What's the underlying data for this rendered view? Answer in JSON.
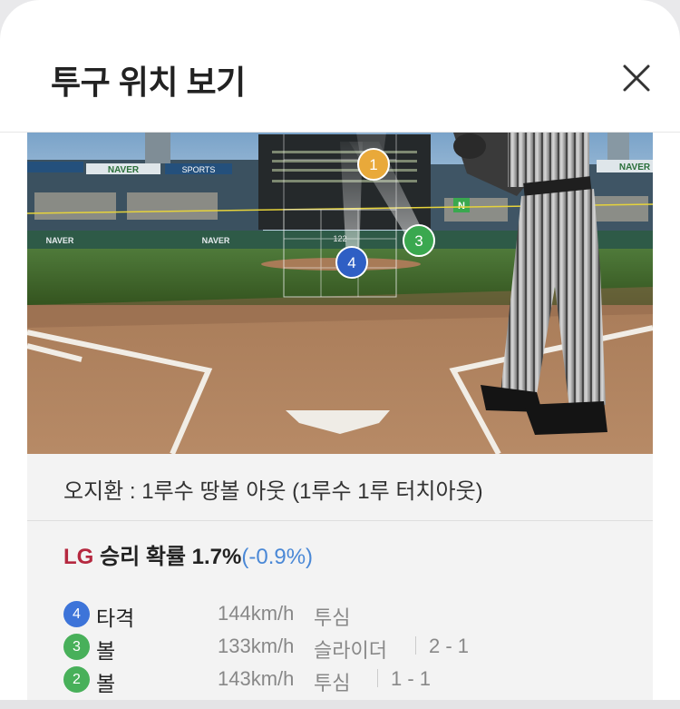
{
  "header": {
    "title": "투구 위치 보기"
  },
  "scene": {
    "banner_left": "NAVER",
    "banner_sports": "SPORTS",
    "banner_center": "NAVER",
    "banner_right": "NAVER",
    "zone_speed": "122",
    "markers": [
      {
        "number": "1",
        "color": "#e9a93a"
      },
      {
        "number": "3",
        "color": "#3aa84f"
      },
      {
        "number": "4",
        "color": "#2f5fc4"
      }
    ]
  },
  "play_result": "오지환 : 1루수 땅볼 아웃 (1루수 1루 터치아웃)",
  "win_probability": {
    "team": "LG",
    "label": "승리 확률 1.7%",
    "delta": "(-0.9%)"
  },
  "pitches": [
    {
      "number": "4",
      "color": "#3d74d9",
      "result": "타격",
      "speed": "144km/h",
      "type": "투심",
      "count": ""
    },
    {
      "number": "3",
      "color": "#48b05a",
      "result": "볼",
      "speed": "133km/h",
      "type": "슬라이더",
      "count": "2 - 1"
    },
    {
      "number": "2",
      "color": "#48b05a",
      "result": "볼",
      "speed": "143km/h",
      "type": "투심",
      "count": "1 - 1"
    }
  ]
}
